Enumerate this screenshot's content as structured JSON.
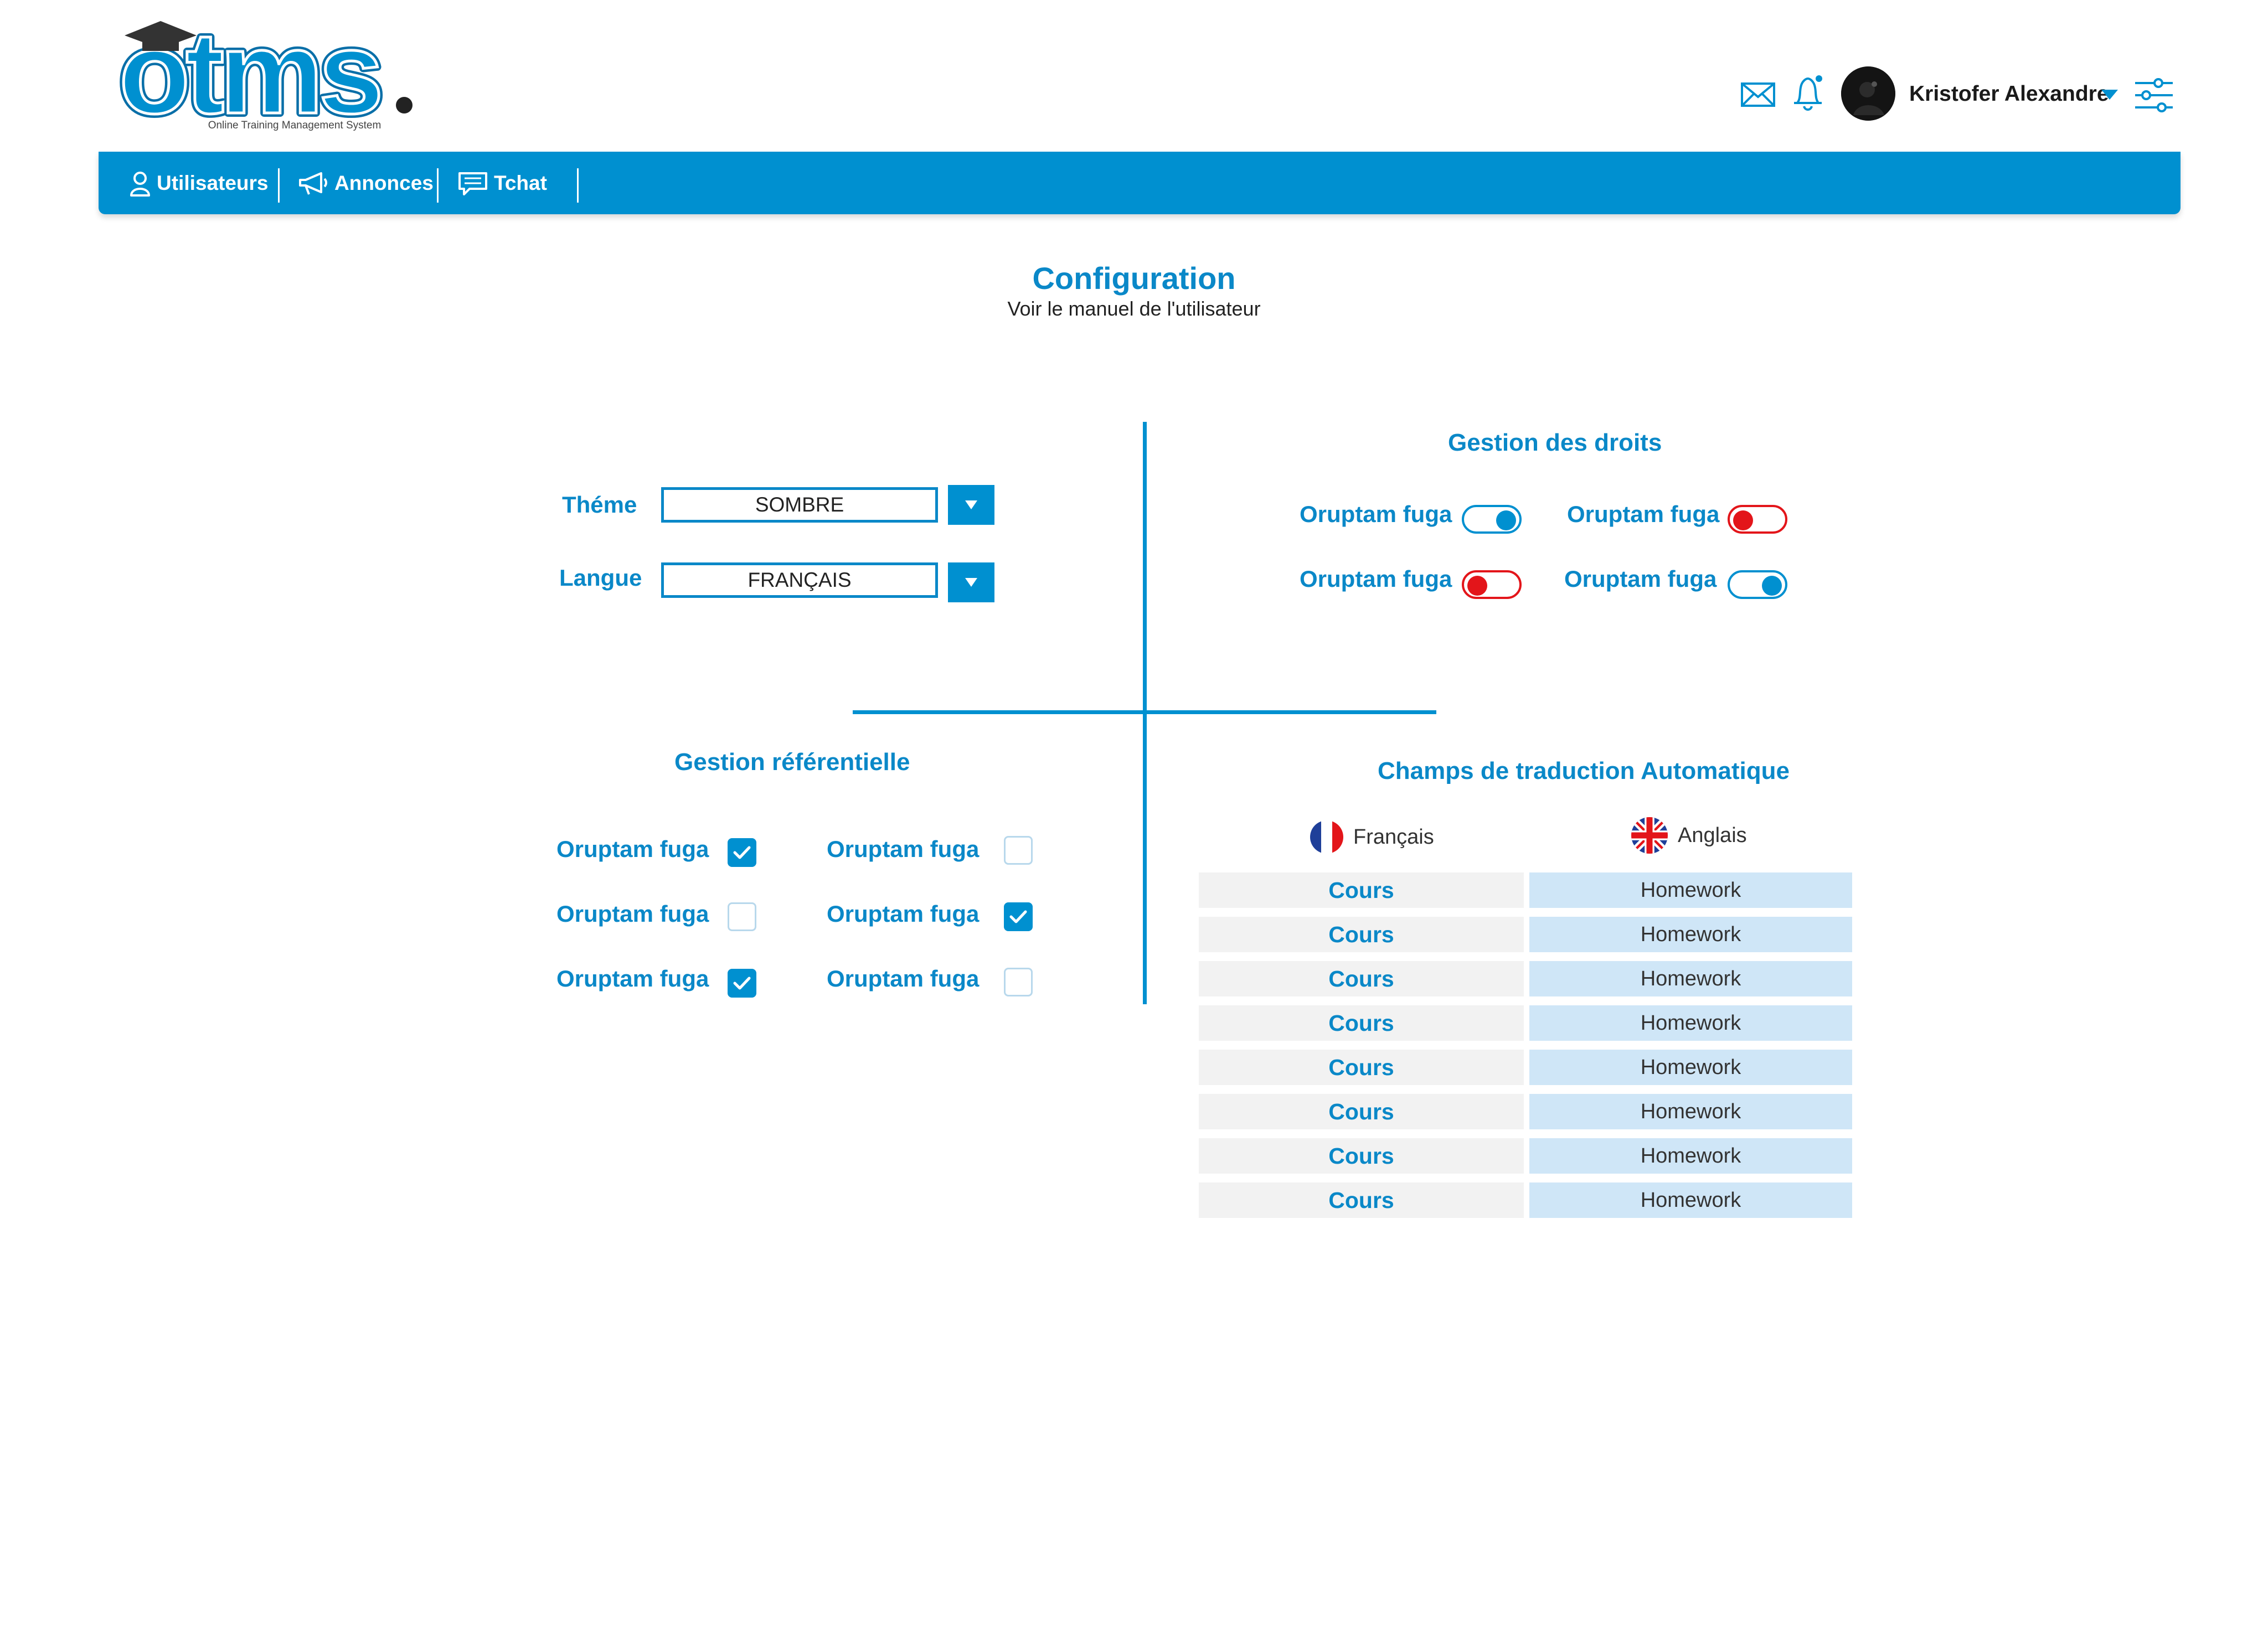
{
  "brand": {
    "logo_text": "otms.",
    "tagline": "Online Training Management System",
    "primary_color": "#0090d0",
    "danger_color": "#e3151a"
  },
  "header": {
    "icons": [
      "mail-icon",
      "bell-icon",
      "settings-sliders-icon"
    ],
    "user": {
      "name": "Kristofer Alexandre"
    }
  },
  "nav": {
    "items": [
      {
        "label": "Utilisateurs",
        "icon": "user-icon"
      },
      {
        "label": "Annonces",
        "icon": "megaphone-icon"
      },
      {
        "label": "Tchat",
        "icon": "chat-icon"
      }
    ]
  },
  "page": {
    "title": "Configuration",
    "subtitle": "Voir le manuel de l'utilisateur"
  },
  "settings": {
    "theme_label": "Théme",
    "theme_value": "SOMBRE",
    "language_label": "Langue",
    "language_value": "FRANÇAIS"
  },
  "rights": {
    "title": "Gestion des droits",
    "items": [
      {
        "label": "Oruptam fuga",
        "on": true
      },
      {
        "label": "Oruptam fuga",
        "on": false
      },
      {
        "label": "Oruptam fuga",
        "on": false
      },
      {
        "label": "Oruptam fuga",
        "on": true
      }
    ]
  },
  "referential": {
    "title": "Gestion référentielle",
    "items": [
      {
        "label": "Oruptam fuga",
        "checked": true
      },
      {
        "label": "Oruptam fuga",
        "checked": false
      },
      {
        "label": "Oruptam fuga",
        "checked": false
      },
      {
        "label": "Oruptam fuga",
        "checked": true
      },
      {
        "label": "Oruptam fuga",
        "checked": true
      },
      {
        "label": "Oruptam fuga",
        "checked": false
      }
    ]
  },
  "translation": {
    "title": "Champs de traduction Automatique",
    "source_lang": "Français",
    "target_lang": "Anglais",
    "rows": [
      {
        "fr": "Cours",
        "en": "Homework"
      },
      {
        "fr": "Cours",
        "en": "Homework"
      },
      {
        "fr": "Cours",
        "en": "Homework"
      },
      {
        "fr": "Cours",
        "en": "Homework"
      },
      {
        "fr": "Cours",
        "en": "Homework"
      },
      {
        "fr": "Cours",
        "en": "Homework"
      },
      {
        "fr": "Cours",
        "en": "Homework"
      },
      {
        "fr": "Cours",
        "en": "Homework"
      }
    ]
  }
}
